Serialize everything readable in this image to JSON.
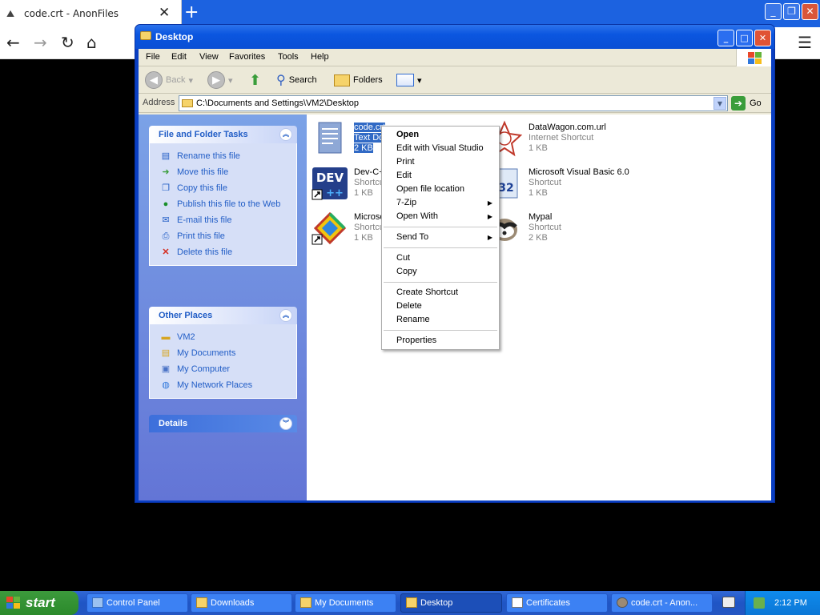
{
  "browser": {
    "tab_title": "code.crt - AnonFiles",
    "new_tab": "+",
    "tab_close": "✕",
    "nav": {
      "back": "←",
      "forward": "→",
      "reload": "↻",
      "home": "⌂",
      "menu": "☰"
    }
  },
  "window": {
    "title": "Desktop",
    "menus": [
      "File",
      "Edit",
      "View",
      "Favorites",
      "Tools",
      "Help"
    ],
    "toolbar": {
      "back": "Back",
      "search": "Search",
      "folders": "Folders"
    },
    "address": {
      "label": "Address",
      "value": "C:\\Documents and Settings\\VM2\\Desktop",
      "go": "Go"
    },
    "tasks_panel": {
      "title": "File and Folder Tasks",
      "items": [
        "Rename this file",
        "Move this file",
        "Copy this file",
        "Publish this file to the Web",
        "E-mail this file",
        "Print this file",
        "Delete this file"
      ]
    },
    "places_panel": {
      "title": "Other Places",
      "items": [
        "VM2",
        "My Documents",
        "My Computer",
        "My Network Places"
      ]
    },
    "details_panel": {
      "title": "Details"
    },
    "files": [
      {
        "name": "code.crt",
        "type": "Text Do",
        "size": "2 KB",
        "icon": "text-document-icon",
        "selected": true
      },
      {
        "name": "DataWagon.com.url",
        "type": "Internet Shortcut",
        "size": "1 KB",
        "icon": "internet-shortcut-icon"
      },
      {
        "name": "Dev-C+",
        "type": "Shortcu",
        "size": "1 KB",
        "icon": "devcpp-icon"
      },
      {
        "name": "Microsoft Visual Basic 6.0",
        "type": "Shortcut",
        "size": "1 KB",
        "icon": "visual-basic-icon"
      },
      {
        "name": "Microso",
        "type": "Shortcu",
        "size": "1 KB",
        "icon": "visual-studio-icon"
      },
      {
        "name": "Mypal",
        "type": "Shortcut",
        "size": "2 KB",
        "icon": "mypal-icon"
      }
    ]
  },
  "context_menu": {
    "groups": [
      [
        {
          "label": "Open",
          "bold": true
        },
        {
          "label": "Edit with Visual Studio"
        },
        {
          "label": "Print"
        },
        {
          "label": "Edit"
        },
        {
          "label": "Open file location"
        },
        {
          "label": "7-Zip",
          "submenu": true
        },
        {
          "label": "Open With",
          "submenu": true
        }
      ],
      [
        {
          "label": "Send To",
          "submenu": true
        }
      ],
      [
        {
          "label": "Cut"
        },
        {
          "label": "Copy"
        }
      ],
      [
        {
          "label": "Create Shortcut"
        },
        {
          "label": "Delete"
        },
        {
          "label": "Rename"
        }
      ],
      [
        {
          "label": "Properties"
        }
      ]
    ]
  },
  "taskbar": {
    "start": "start",
    "tasks": [
      {
        "label": "Control Panel"
      },
      {
        "label": "Downloads"
      },
      {
        "label": "My Documents"
      },
      {
        "label": "Desktop",
        "active": true
      },
      {
        "label": "Certificates"
      },
      {
        "label": "code.crt - Anon..."
      }
    ],
    "clock": "2:12 PM"
  },
  "colors": {
    "xp_blue": "#0a4fd4",
    "task_pane_link": "#215dc6",
    "selection": "#316ac5",
    "start_green": "#3c9a3c"
  }
}
